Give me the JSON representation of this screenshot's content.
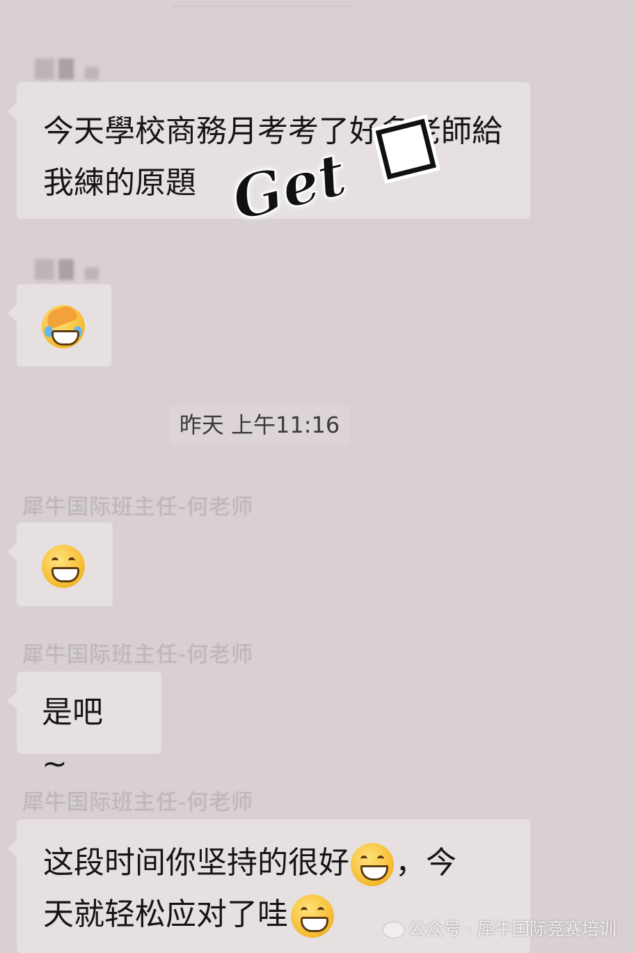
{
  "messages": [
    {
      "text": "今天學校商務月考考了好多老師給我練的原題"
    },
    {
      "emoji": "facepalm-laugh-emoji"
    },
    {
      "sender": "犀牛国际班主任-何老师",
      "emoji": "grin-emoji"
    },
    {
      "sender": "犀牛国际班主任-何老师",
      "text": "是吧 ~"
    },
    {
      "sender": "犀牛国际班主任-何老师",
      "text_line1": "这段时间你坚持的很好",
      "text_line1b": "，今",
      "text_line2": "天就轻松应对了哇"
    }
  ],
  "timestamp": "昨天 上午11:16",
  "sticker_text": "Get",
  "watermark": "公众号 · 犀牛国际竞赛培训",
  "colors": {
    "background": "#d8d0d1",
    "bubble": "#e6e0e1",
    "emoji": "#f5b92d"
  }
}
